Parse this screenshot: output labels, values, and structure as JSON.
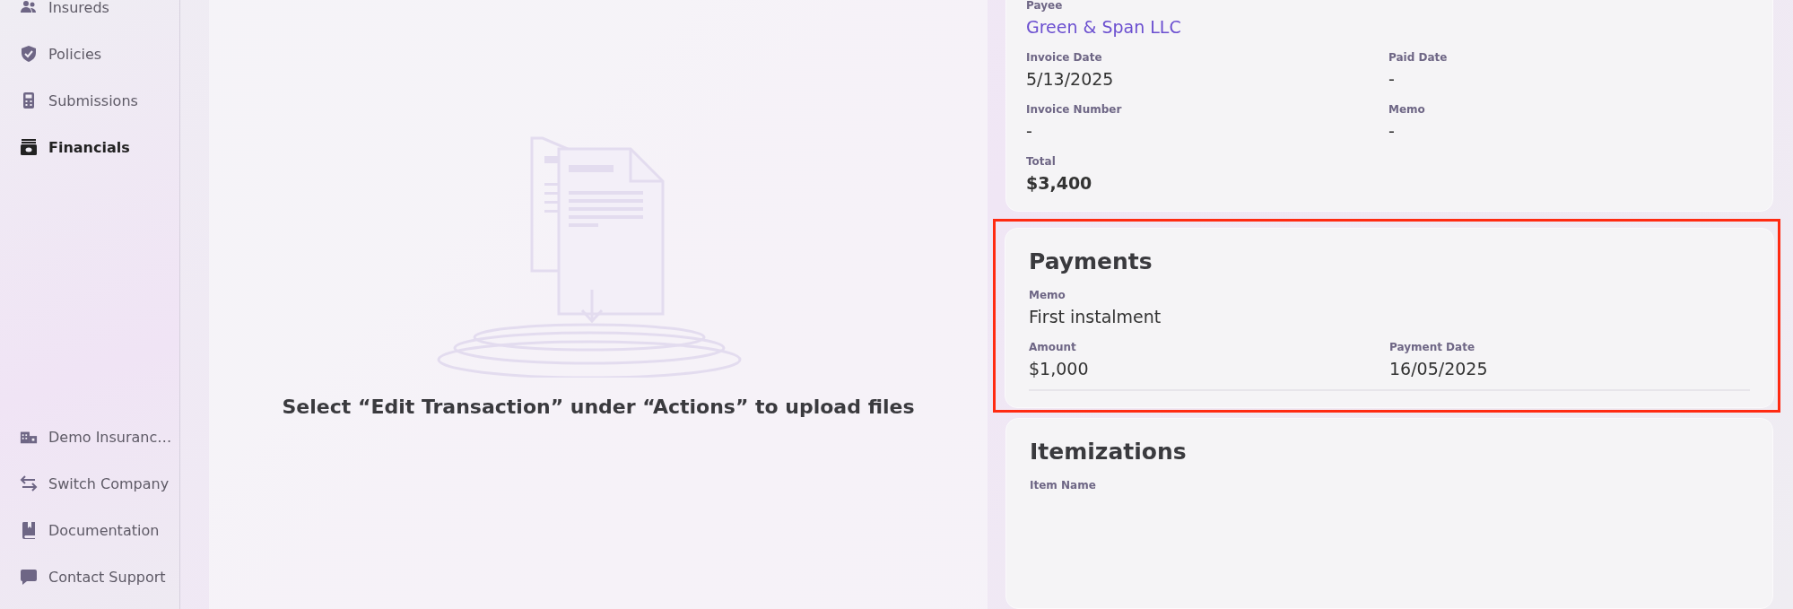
{
  "sidebar": {
    "top_items": [
      {
        "label": "Insureds",
        "selected": false
      },
      {
        "label": "Policies",
        "selected": false
      },
      {
        "label": "Submissions",
        "selected": false
      },
      {
        "label": "Financials",
        "selected": true
      }
    ],
    "bottom_items": [
      {
        "label": "Demo Insuranc…"
      },
      {
        "label": "Switch Company"
      },
      {
        "label": "Documentation"
      },
      {
        "label": "Contact Support"
      }
    ]
  },
  "upload_panel": {
    "message": "Select “Edit Transaction” under “Actions” to upload files"
  },
  "details_card": {
    "payee_label": "Payee",
    "payee": "Green & Span LLC",
    "fields": [
      {
        "label": "Invoice Date",
        "value": "5/13/2025"
      },
      {
        "label": "Paid Date",
        "value": "-"
      },
      {
        "label": "Invoice Number",
        "value": "-"
      },
      {
        "label": "Memo",
        "value": "-"
      }
    ],
    "total_label": "Total",
    "total": "$3,400"
  },
  "payments_card": {
    "title": "Payments",
    "highlighted": true,
    "memo_label": "Memo",
    "memo": "First instalment",
    "fields": [
      {
        "label": "Amount",
        "value": "$1,000"
      },
      {
        "label": "Payment Date",
        "value": "16/05/2025"
      }
    ]
  },
  "itemizations_card": {
    "title": "Itemizations",
    "column_label": "Item Name"
  }
}
